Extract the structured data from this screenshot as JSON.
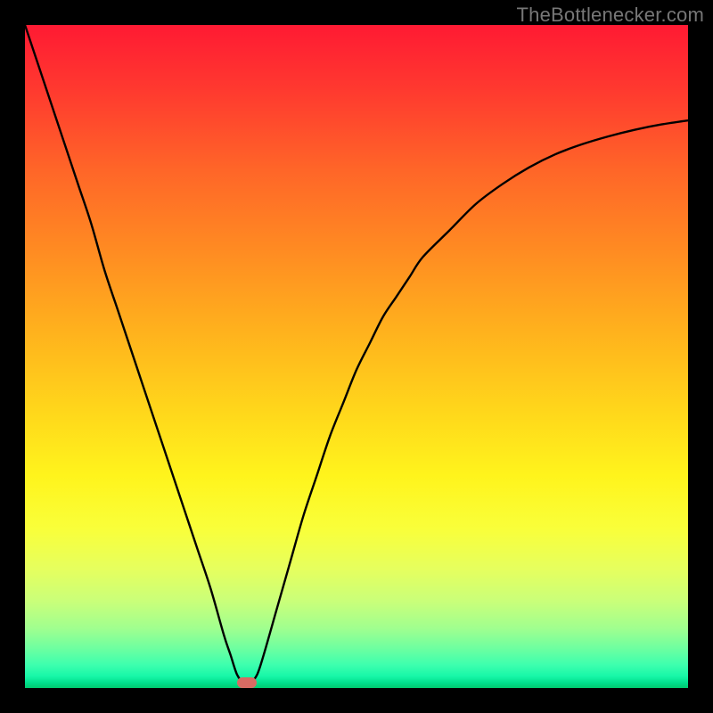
{
  "watermark": {
    "text": "TheBottlenecker.com"
  },
  "chart_data": {
    "type": "line",
    "title": "",
    "xlabel": "",
    "ylabel": "",
    "xlim": [
      0,
      100
    ],
    "ylim": [
      0,
      100
    ],
    "x": [
      0,
      2,
      4,
      6,
      8,
      10,
      12,
      14,
      16,
      18,
      20,
      22,
      24,
      26,
      28,
      30,
      31,
      32,
      33,
      34,
      35,
      36,
      38,
      40,
      42,
      44,
      46,
      48,
      50,
      52,
      54,
      56,
      58,
      60,
      64,
      68,
      72,
      76,
      80,
      84,
      88,
      92,
      96,
      100
    ],
    "values": [
      100,
      94,
      88,
      82,
      76,
      70,
      63,
      57,
      51,
      45,
      39,
      33,
      27,
      21,
      15,
      8,
      5,
      2,
      0.8,
      0.8,
      2,
      5,
      12,
      19,
      26,
      32,
      38,
      43,
      48,
      52,
      56,
      59,
      62,
      65,
      69,
      73,
      76,
      78.5,
      80.5,
      82,
      83.2,
      84.2,
      85,
      85.6
    ],
    "marker": {
      "x": 33.5,
      "y": 0.8
    },
    "background_gradient": {
      "top_color": "#ff1a33",
      "mid_color": "#ffd61b",
      "bottom_color": "#00c96f"
    }
  }
}
